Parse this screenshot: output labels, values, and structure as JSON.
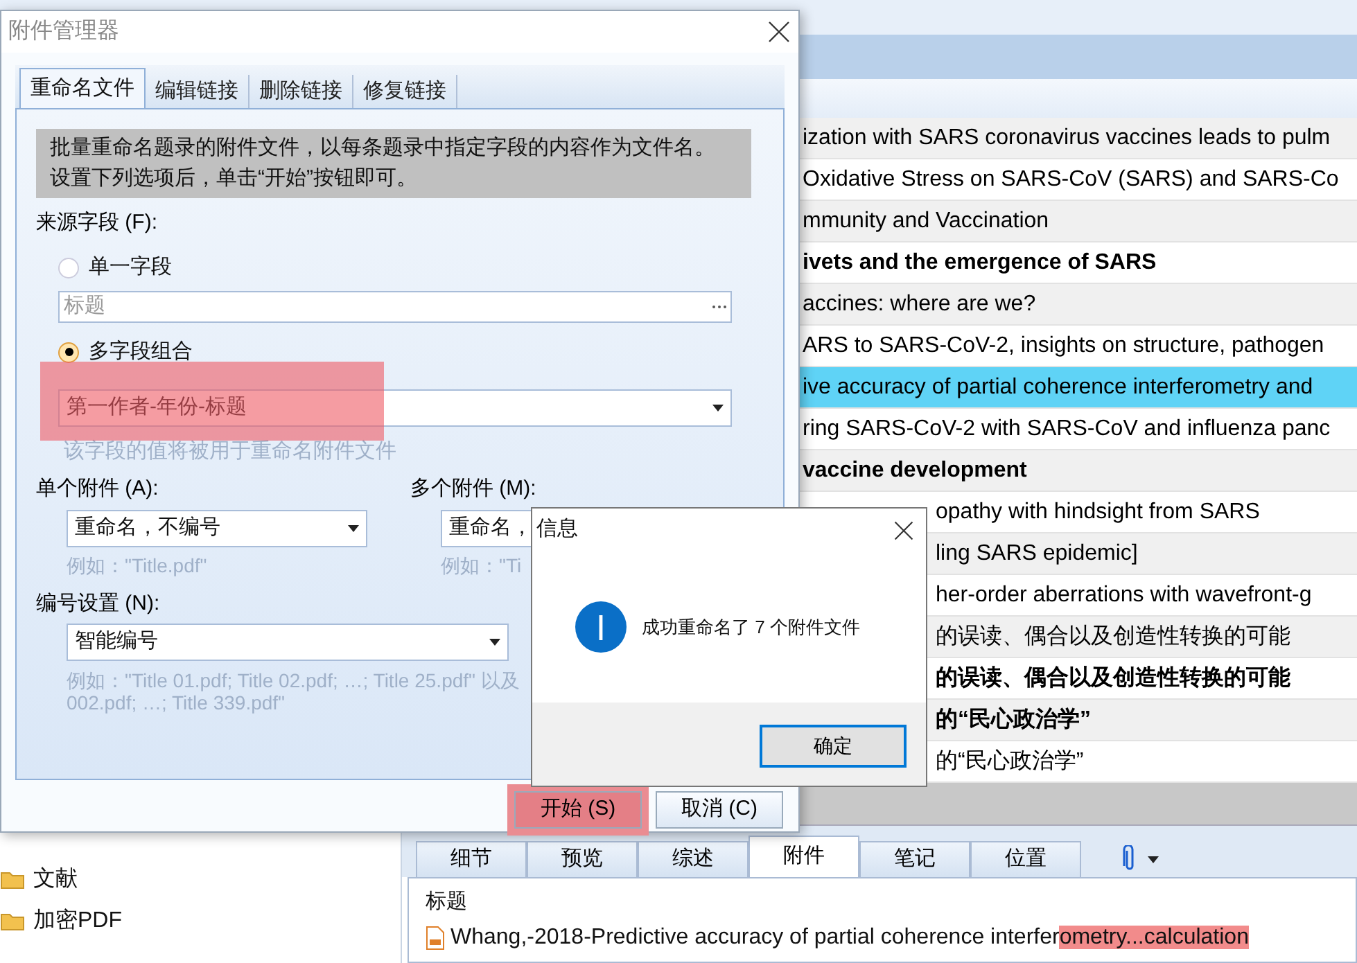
{
  "list_rows": [
    {
      "title": "ization with SARS coronavirus vaccines leads to pulm",
      "bold": false,
      "selected": false
    },
    {
      "title": "Oxidative Stress on SARS-CoV (SARS) and SARS-Co",
      "bold": false,
      "selected": false
    },
    {
      "title": "mmunity and Vaccination",
      "bold": false,
      "selected": false
    },
    {
      "title": "ivets and the emergence of SARS",
      "bold": true,
      "selected": false
    },
    {
      "title": "accines: where are we?",
      "bold": false,
      "selected": false
    },
    {
      "title": "ARS to SARS-CoV-2, insights on structure, pathogen",
      "bold": false,
      "selected": false
    },
    {
      "title": "ive accuracy of partial coherence interferometry and",
      "bold": false,
      "selected": true
    },
    {
      "title": "ring SARS-CoV-2 with SARS-CoV and influenza panc",
      "bold": false,
      "selected": false
    },
    {
      "title": "vaccine development",
      "bold": true,
      "selected": false
    },
    {
      "title": "opathy with hindsight from SARS",
      "bold": false,
      "selected": false
    },
    {
      "title": "ling SARS epidemic]",
      "bold": false,
      "selected": false
    },
    {
      "title": "her-order aberrations with wavefront-g",
      "bold": false,
      "selected": false
    },
    {
      "title": "的误读、偶合以及创造性转换的可能",
      "bold": false,
      "selected": false
    },
    {
      "title": "的误读、偶合以及创造性转换的可能",
      "bold": true,
      "selected": false
    },
    {
      "title": "的“民心政治学”",
      "bold": true,
      "selected": false
    },
    {
      "title": "的“民心政治学”",
      "bold": false,
      "selected": false
    }
  ],
  "tree": [
    {
      "label": "文献"
    },
    {
      "label": "加密PDF"
    }
  ],
  "bottom_tabs": [
    {
      "label": "细节",
      "selected": false
    },
    {
      "label": "预览",
      "selected": false
    },
    {
      "label": "综述",
      "selected": false
    },
    {
      "label": "附件",
      "selected": true
    },
    {
      "label": "笔记",
      "selected": false
    },
    {
      "label": "位置",
      "selected": false
    }
  ],
  "attachments": {
    "column": "标题",
    "files": [
      {
        "name": "Whang,-2018-Predictive accuracy of partial coherence interfer",
        "highlight": "ometry...calculation"
      }
    ]
  },
  "manager": {
    "title": "附件管理器",
    "tabs": [
      {
        "label": "重命名文件",
        "selected": true
      },
      {
        "label": "编辑链接",
        "selected": false
      },
      {
        "label": "删除链接",
        "selected": false
      },
      {
        "label": "修复链接",
        "selected": false
      }
    ],
    "intro": [
      "批量重命名题录的附件文件，以每条题录中指定字段的内容作为文件名。",
      "设置下列选项后，单击“开始”按钮即可。"
    ],
    "source_label": "来源字段 (F):",
    "options": [
      {
        "label": "单一字段",
        "selected": false,
        "kind": "browse",
        "field": "标题"
      },
      {
        "label": "多字段组合",
        "selected": true,
        "kind": "dropdown",
        "field": "第一作者-年份-标题",
        "highlighted": true
      }
    ],
    "source_hint": "该字段的值将被用于重命名附件文件",
    "single": {
      "label": "单个附件 (A):",
      "value": "重命名，不编号",
      "example": "例如：\"Title.pdf\""
    },
    "multiple": {
      "label": "多个附件 (M):",
      "value": "重命名，",
      "example": "例如：\"Ti"
    },
    "numbering": {
      "label": "编号设置 (N):",
      "value": "智能编号",
      "example": [
        "例如：\"Title 01.pdf; Title 02.pdf; …; Title 25.pdf\" 以及",
        "002.pdf; …; Title 339.pdf\""
      ]
    },
    "buttons": [
      {
        "label": "开始 (S)",
        "highlighted": true
      },
      {
        "label": "取消 (C)",
        "highlighted": false
      }
    ]
  },
  "message": {
    "title": "信息",
    "text": "成功重命名了 7 个附件文件",
    "button": "确定"
  }
}
